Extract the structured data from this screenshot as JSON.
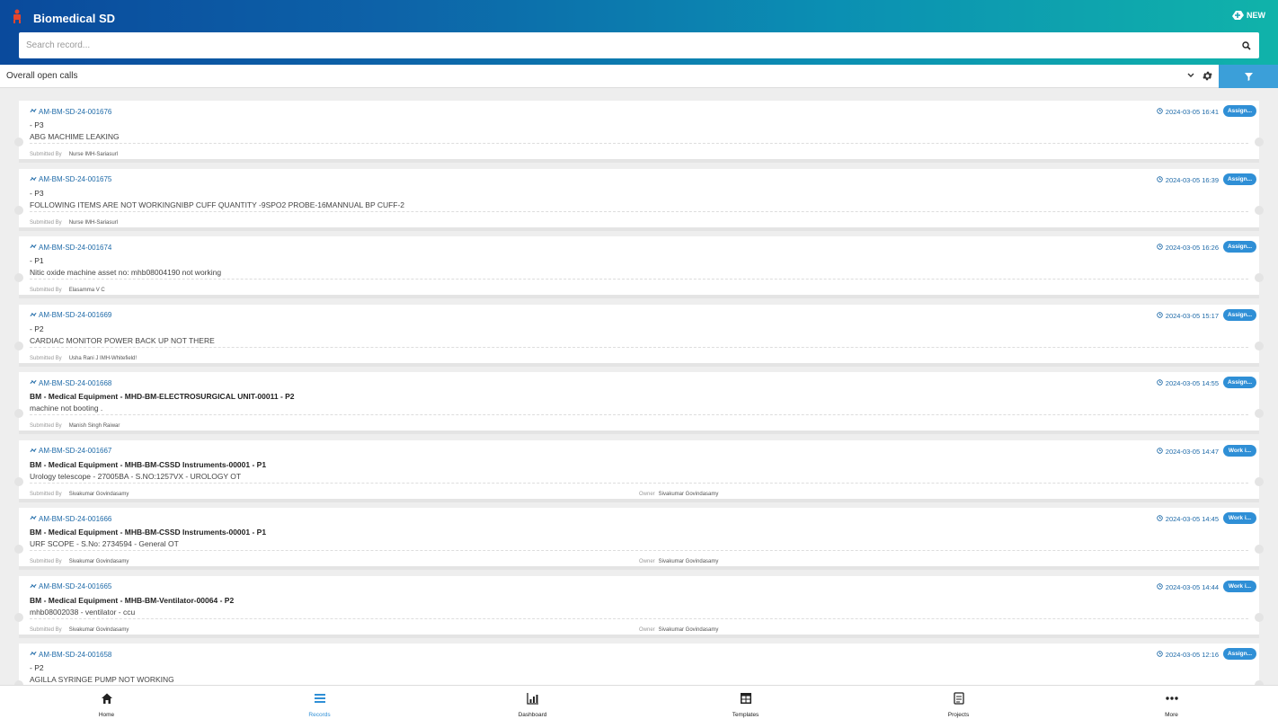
{
  "app": {
    "title": "Biomedical SD",
    "new_label": "NEW",
    "accent": "#2f8fd6"
  },
  "search": {
    "placeholder": "Search record...",
    "value": ""
  },
  "filter": {
    "selected_view": "Overall open calls"
  },
  "records": [
    {
      "id": "AM-BM-SD-24-001676",
      "title": "- P3",
      "title_bold": false,
      "description": "ABG MACHIME LEAKING",
      "submitted_by_label": "Submitted By",
      "submitted_by": "Nurse IMH-Sariasurl",
      "owner_label": "",
      "owner": "",
      "timestamp": "2024-03-05 16:41",
      "status": "Assign..."
    },
    {
      "id": "AM-BM-SD-24-001675",
      "title": "- P3",
      "title_bold": false,
      "description": "FOLLOWING ITEMS ARE NOT WORKINGNIBP CUFF QUANTITY -9SPO2 PROBE-16MANNUAL BP CUFF-2",
      "submitted_by_label": "Submitted By",
      "submitted_by": "Nurse IMH-Sariasurl",
      "owner_label": "",
      "owner": "",
      "timestamp": "2024-03-05 16:39",
      "status": "Assign..."
    },
    {
      "id": "AM-BM-SD-24-001674",
      "title": "- P1",
      "title_bold": false,
      "description": "Nitic oxide machine asset no: mhb08004190 not working",
      "submitted_by_label": "Submitted By",
      "submitted_by": "Elasamma V C",
      "owner_label": "",
      "owner": "",
      "timestamp": "2024-03-05 16:26",
      "status": "Assign..."
    },
    {
      "id": "AM-BM-SD-24-001669",
      "title": "- P2",
      "title_bold": false,
      "description": "CARDIAC MONITOR POWER BACK UP NOT THERE",
      "submitted_by_label": "Submitted By",
      "submitted_by": "Usha Rani J IMH-Whitefield!",
      "owner_label": "",
      "owner": "",
      "timestamp": "2024-03-05 15:17",
      "status": "Assign..."
    },
    {
      "id": "AM-BM-SD-24-001668",
      "title": "BM - Medical Equipment - MHD-BM-ELECTROSURGICAL UNIT-00011 - P2",
      "title_bold": true,
      "description": "machine not booting .",
      "submitted_by_label": "Submitted By",
      "submitted_by": "Manish Singh Raiwar",
      "owner_label": "",
      "owner": "",
      "timestamp": "2024-03-05 14:55",
      "status": "Assign..."
    },
    {
      "id": "AM-BM-SD-24-001667",
      "title": "BM - Medical Equipment - MHB-BM-CSSD Instruments-00001 - P1",
      "title_bold": true,
      "description": "Urology telescope - 27005BA - S.NO:1257VX - UROLOGY OT",
      "submitted_by_label": "Submitted By",
      "submitted_by": "Sivakumar Govindasamy",
      "owner_label": "Owner",
      "owner": "Sivakumar Govindasamy",
      "timestamp": "2024-03-05 14:47",
      "status": "Work i..."
    },
    {
      "id": "AM-BM-SD-24-001666",
      "title": "BM - Medical Equipment - MHB-BM-CSSD Instruments-00001 - P1",
      "title_bold": true,
      "description": "URF SCOPE - S.No: 2734594 - General OT",
      "submitted_by_label": "Submitted By",
      "submitted_by": "Sivakumar Govindasamy",
      "owner_label": "Owner",
      "owner": "Sivakumar Govindasamy",
      "timestamp": "2024-03-05 14:45",
      "status": "Work i..."
    },
    {
      "id": "AM-BM-SD-24-001665",
      "title": "BM - Medical Equipment - MHB-BM-Ventilator-00064 - P2",
      "title_bold": true,
      "description": "mhb08002038 - ventilator - ccu",
      "submitted_by_label": "Submitted By",
      "submitted_by": "Sivakumar Govindasamy",
      "owner_label": "Owner",
      "owner": "Sivakumar Govindasamy",
      "timestamp": "2024-03-05 14:44",
      "status": "Work i..."
    },
    {
      "id": "AM-BM-SD-24-001658",
      "title": "- P2",
      "title_bold": false,
      "description": "AGILLA SYRINGE PUMP NOT WORKING",
      "submitted_by_label": "",
      "submitted_by": "",
      "owner_label": "",
      "owner": "",
      "timestamp": "2024-03-05 12:16",
      "status": "Assign..."
    }
  ],
  "nav": [
    {
      "label": "Home",
      "icon": "home-icon",
      "active": false
    },
    {
      "label": "Records",
      "icon": "records-icon",
      "active": true
    },
    {
      "label": "Dashboard",
      "icon": "dashboard-icon",
      "active": false
    },
    {
      "label": "Templates",
      "icon": "templates-icon",
      "active": false
    },
    {
      "label": "Projects",
      "icon": "projects-icon",
      "active": false
    },
    {
      "label": "More",
      "icon": "more-icon",
      "active": false
    }
  ]
}
